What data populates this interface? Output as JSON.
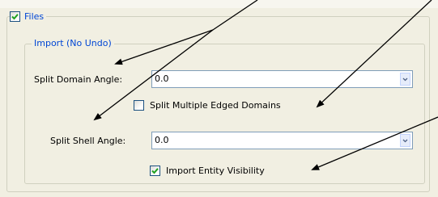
{
  "files_group": {
    "checked": true,
    "label": "Files"
  },
  "import_group": {
    "title": "Import (No Undo)"
  },
  "split_domain_angle": {
    "label": "Split Domain Angle:",
    "value": "0.0"
  },
  "split_multiple_edged_domains": {
    "checked": false,
    "label": "Split Multiple Edged Domains"
  },
  "split_shell_angle": {
    "label": "Split Shell Angle:",
    "value": "0.0"
  },
  "import_entity_visibility": {
    "checked": true,
    "label": "Import Entity Visibility"
  },
  "colors": {
    "panel_bg": "#f1efe2",
    "group_title": "#0046d5",
    "check_mark": "#21a121",
    "combo_border": "#7f9db9"
  }
}
